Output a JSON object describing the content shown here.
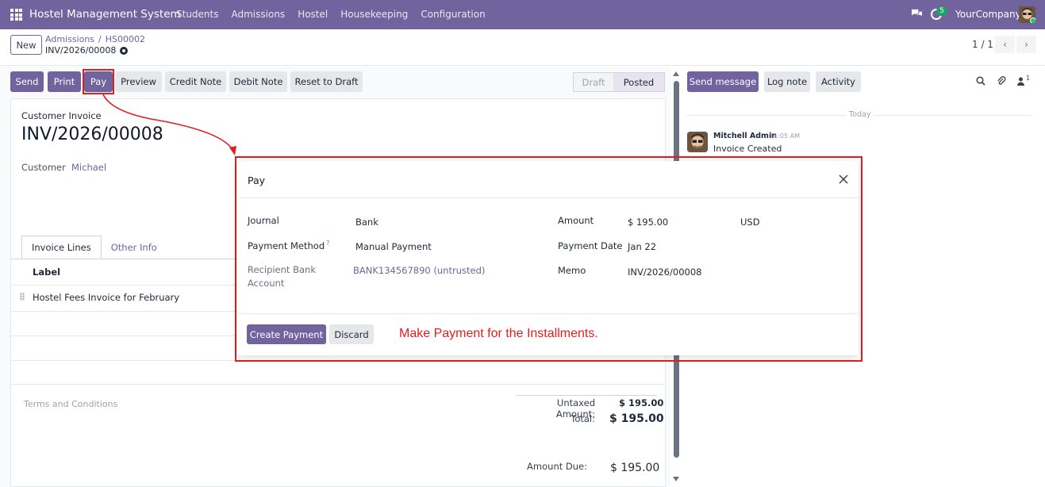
{
  "topbar": {
    "app_name": "Hostel Management System",
    "menu": [
      "Students",
      "Admissions",
      "Hostel",
      "Housekeeping",
      "Configuration"
    ],
    "activity_count": "5",
    "company": "YourCompany"
  },
  "control": {
    "new_label": "New",
    "breadcrumb": [
      "Admissions",
      "HS00002"
    ],
    "record_name": "INV/2026/00008",
    "pager": "1 / 1",
    "prev": "‹",
    "next": "›"
  },
  "actions": {
    "send": "Send",
    "print": "Print",
    "pay": "Pay",
    "preview": "Preview",
    "credit_note": "Credit Note",
    "debit_note": "Debit Note",
    "reset_to_draft": "Reset to Draft"
  },
  "status": {
    "draft": "Draft",
    "posted": "Posted"
  },
  "invoice": {
    "type": "Customer Invoice",
    "name": "INV/2026/00008",
    "customer_label": "Customer",
    "customer_value": "Michael",
    "tabs": [
      "Invoice Lines",
      "Other Info"
    ],
    "col_label": "Label",
    "line": "Hostel Fees Invoice for February",
    "terms": "Terms and Conditions",
    "untaxed_label": "Untaxed Amount:",
    "untaxed_value": "$ 195.00",
    "total_label": "Total:",
    "total_value": "$ 195.00",
    "amount_due_label": "Amount Due:",
    "amount_due_value": "$ 195.00"
  },
  "chatter": {
    "send_message": "Send message",
    "log_note": "Log note",
    "activity": "Activity",
    "followers_count": "1",
    "today": "Today",
    "author": "Mitchell Admin",
    "time": "11:05 AM",
    "body": "Invoice Created"
  },
  "modal": {
    "title": "Pay",
    "journal_label": "Journal",
    "journal_value": "Bank",
    "payment_method_label": "Payment Method",
    "payment_method_help": "?",
    "payment_method_value": "Manual Payment",
    "recipient_label": "Recipient Bank Account",
    "recipient_value": "BANK134567890 (untrusted)",
    "amount_label": "Amount",
    "amount_value": "$ 195.00",
    "currency": "USD",
    "payment_date_label": "Payment Date",
    "payment_date_value": "Jan 22",
    "memo_label": "Memo",
    "memo_value": "INV/2026/00008",
    "create_payment": "Create Payment",
    "discard": "Discard",
    "annotation": "Make Payment for the Installments."
  },
  "colors": {
    "brand": "#71639e",
    "annotation_red": "#e21d1d"
  }
}
